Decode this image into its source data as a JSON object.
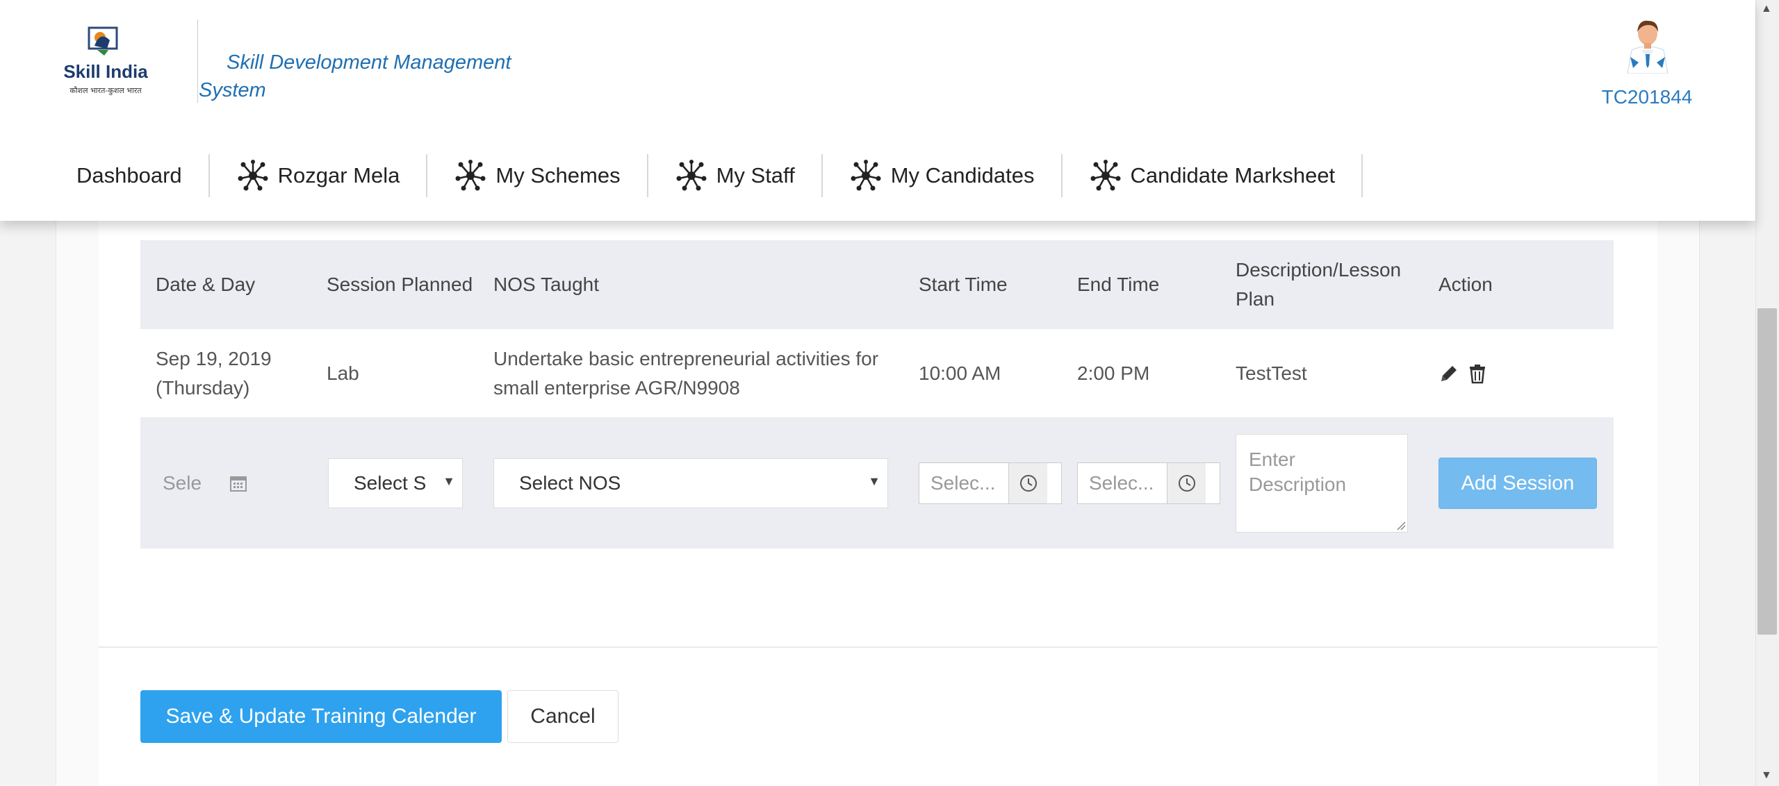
{
  "header": {
    "logo": {
      "brand": "Skill India",
      "tagline": "कौशल भारत-कुशल भारत"
    },
    "app_title": "Skill Development Management System",
    "user_id": "TC201844"
  },
  "nav": {
    "items": [
      {
        "label": "Dashboard",
        "icon": ""
      },
      {
        "label": "Rozgar Mela",
        "icon": "network-icon"
      },
      {
        "label": "My Schemes",
        "icon": "network-icon"
      },
      {
        "label": "My Staff",
        "icon": "network-icon"
      },
      {
        "label": "My Candidates",
        "icon": "network-icon"
      },
      {
        "label": "Candidate Marksheet",
        "icon": "network-icon"
      }
    ]
  },
  "table": {
    "headers": [
      "Date & Day",
      "Session Planned",
      "NOS Taught",
      "Start Time",
      "End Time",
      "Description/Lesson Plan",
      "Action"
    ],
    "rows": [
      {
        "date": "Sep 19, 2019",
        "day": "(Thursday)",
        "session": "Lab",
        "nos": "Undertake basic entrepreneurial activities for small enterprise AGR/N9908",
        "start": "10:00 AM",
        "end": "2:00 PM",
        "description": "TestTest"
      }
    ],
    "edit_row": {
      "date_placeholder": "Sele",
      "session_select": "Select S",
      "nos_select": "Select NOS",
      "start_placeholder": "Selec...",
      "end_placeholder": "Selec...",
      "description_placeholder": "Enter Description",
      "add_button": "Add Session"
    }
  },
  "footer": {
    "save_button": "Save & Update Training Calender",
    "cancel_button": "Cancel"
  },
  "colors": {
    "primary": "#2ea2ee",
    "primary_light": "#74bbef",
    "title_blue": "#1f6fb2",
    "table_header_bg": "#ebedf2"
  }
}
